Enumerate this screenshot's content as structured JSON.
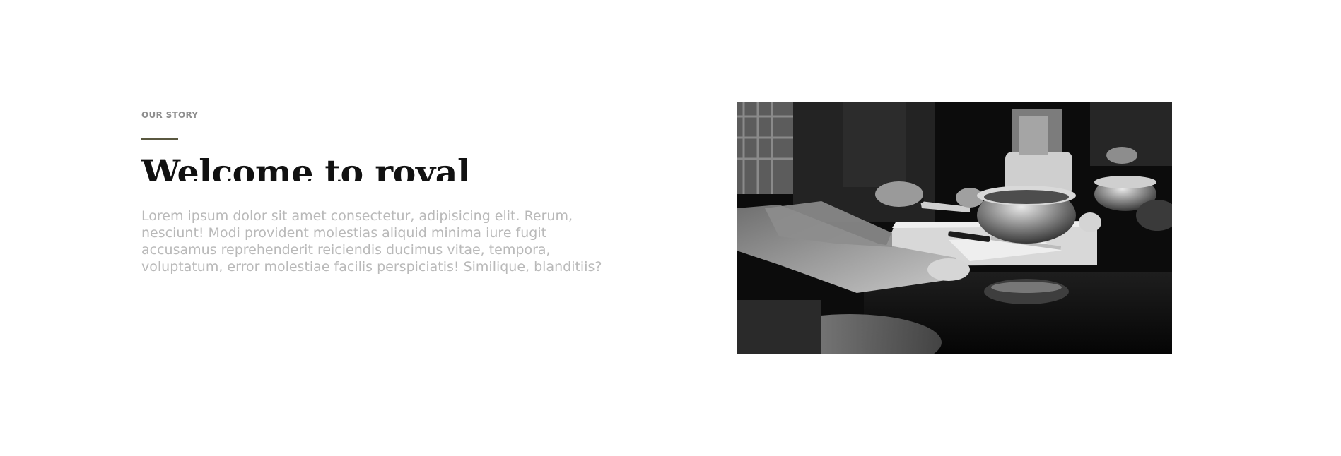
{
  "story": {
    "eyebrow": "OUR STORY",
    "title": "Welcome to royal",
    "body": "Lorem ipsum dolor sit amet consectetur, adipisicing elit. Rerum, nesciunt! Modi provident molestias aliquid minima iure fugit accusamus reprehenderit reiciendis ducimus vitae, tempora, voluptatum, error molestiae facilis perspiciatis! Similique, blanditiis?"
  },
  "colors": {
    "accent": "#5a5840",
    "heading": "#111111",
    "eyebrow": "#8e8e8e",
    "body": "#b9b9b9",
    "background": "#ffffff"
  }
}
